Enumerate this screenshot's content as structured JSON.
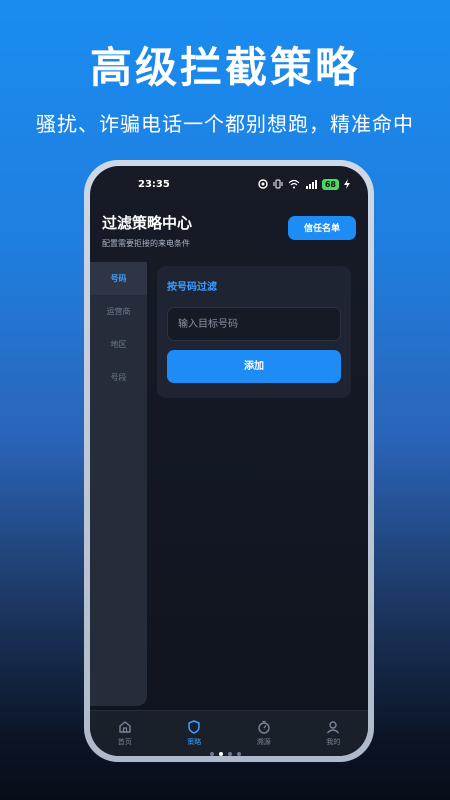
{
  "promo": {
    "headline": "高级拦截策略",
    "subline": "骚扰、诈骗电话一个都别想跑，精准命中"
  },
  "status_bar": {
    "time": "23:35",
    "battery": "68"
  },
  "header": {
    "title": "过滤策略中心",
    "subtitle": "配置需要拒接的来电条件",
    "trust_button": "信任名单"
  },
  "sidebar": {
    "items": [
      {
        "label": "号码",
        "active": true
      },
      {
        "label": "运营商",
        "active": false
      },
      {
        "label": "地区",
        "active": false
      },
      {
        "label": "号段",
        "active": false
      }
    ]
  },
  "filter_card": {
    "title": "按号码过滤",
    "input_value": "",
    "input_placeholder": "输入目标号码",
    "add_button": "添加"
  },
  "bottom_nav": {
    "items": [
      {
        "label": "首页",
        "icon": "home-icon",
        "active": false
      },
      {
        "label": "策略",
        "icon": "shield-icon",
        "active": true
      },
      {
        "label": "溯源",
        "icon": "trace-icon",
        "active": false
      },
      {
        "label": "我的",
        "icon": "user-icon",
        "active": false
      }
    ]
  },
  "pager": {
    "count": 4,
    "active_index": 1
  },
  "colors": {
    "accent": "#1e8cf5",
    "accent_text": "#3e9cff",
    "screen_bg": "#131824",
    "card_bg": "#1e2431"
  }
}
